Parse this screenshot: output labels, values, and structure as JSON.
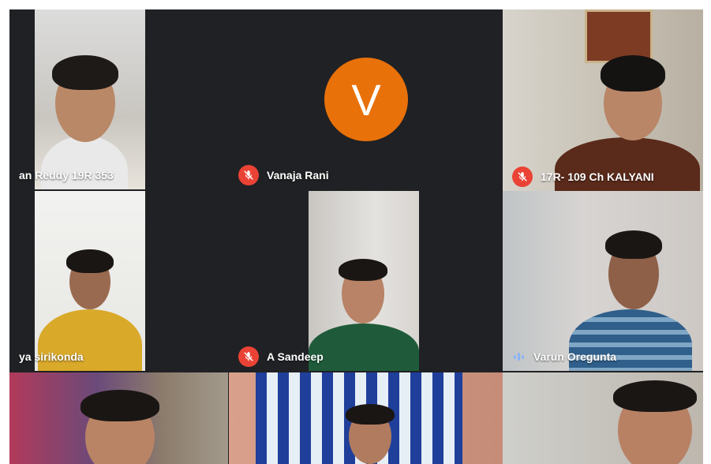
{
  "participants": [
    {
      "name": "an Reddy 19R 353",
      "muted": false
    },
    {
      "name": "Vanaja Rani",
      "muted": true,
      "avatar_letter": "V",
      "avatar_color": "#e8710a"
    },
    {
      "name": "17R- 109 Ch KALYANI",
      "muted": true
    },
    {
      "name": "ya sirikonda",
      "muted": false
    },
    {
      "name": "A Sandeep",
      "muted": true
    },
    {
      "name": "Varun Oregunta",
      "muted": false,
      "speaking": true
    },
    {
      "name": "",
      "muted": false
    },
    {
      "name": "",
      "muted": false
    },
    {
      "name": "",
      "muted": false
    }
  ],
  "colors": {
    "background": "#202124",
    "tile": "#3c4043",
    "mute_badge": "#ea4335",
    "speaking_indicator": "#8ab4f8"
  }
}
